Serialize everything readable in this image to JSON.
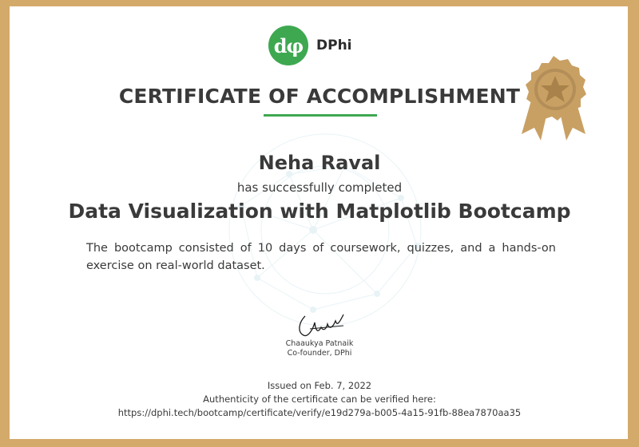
{
  "brand": {
    "logo_glyph": "dφ",
    "name": "DPhi",
    "accent": "#3ea851"
  },
  "certificate": {
    "title": "CERTIFICATE OF ACCOMPLISHMENT",
    "recipient": "Neha Raval",
    "completed_text": "has successfully completed",
    "course": "Data Visualization with Matplotlib Bootcamp",
    "description": "The bootcamp consisted of 10 days of coursework, quizzes, and a hands-on exercise on real-world dataset."
  },
  "signer": {
    "name": "Chaaukya Patnaik",
    "title": "Co-founder, DPhi"
  },
  "footer": {
    "issued": "Issued on Feb. 7, 2022",
    "verify_text": "Authenticity of the certificate can be verified here:",
    "verify_url": "https://dphi.tech/bootcamp/certificate/verify/e19d279a-b005-4a15-91fb-88ea7870aa35"
  },
  "colors": {
    "border": "#d4aa6a",
    "badge_gold": "#c9a063",
    "badge_dark": "#a8824a",
    "text": "#3a3a3a"
  },
  "icons": {
    "badge": "award-ribbon-star-icon",
    "watermark": "brain-network-icon",
    "signature": "handwritten-signature"
  }
}
